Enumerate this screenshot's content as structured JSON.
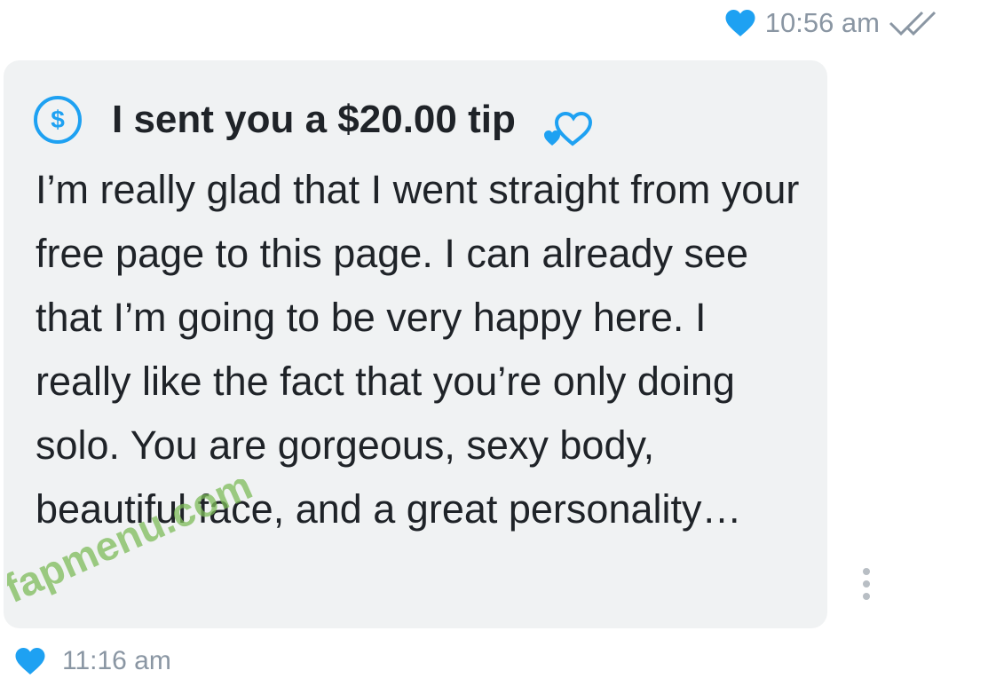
{
  "top_meta": {
    "time": "10:56 am",
    "heart_icon": "heart-icon",
    "read_icon": "double-check-icon"
  },
  "message": {
    "tip_icon": "dollar-circle-icon",
    "tip_title": "I sent you a $20.00 tip",
    "tip_decoration_icon": "hearts-icon",
    "body": "I’m really glad that I went straight from your free page to this page. I can already see that I’m going to be very happy here. I really like the fact that you’re only doing solo. You are gorgeous, sexy body, beautiful face, and a great personality…",
    "more_icon": "more-vertical-icon"
  },
  "bottom_meta": {
    "time": "11:16 am",
    "heart_icon": "heart-icon"
  },
  "watermark": {
    "text": "fapmenu.com"
  },
  "colors": {
    "accent": "#1ea1f2",
    "bubble_bg": "#f0f2f3",
    "meta_text": "#8a96a3",
    "body_text": "#1f2328",
    "watermark": "#7dbb5a"
  }
}
